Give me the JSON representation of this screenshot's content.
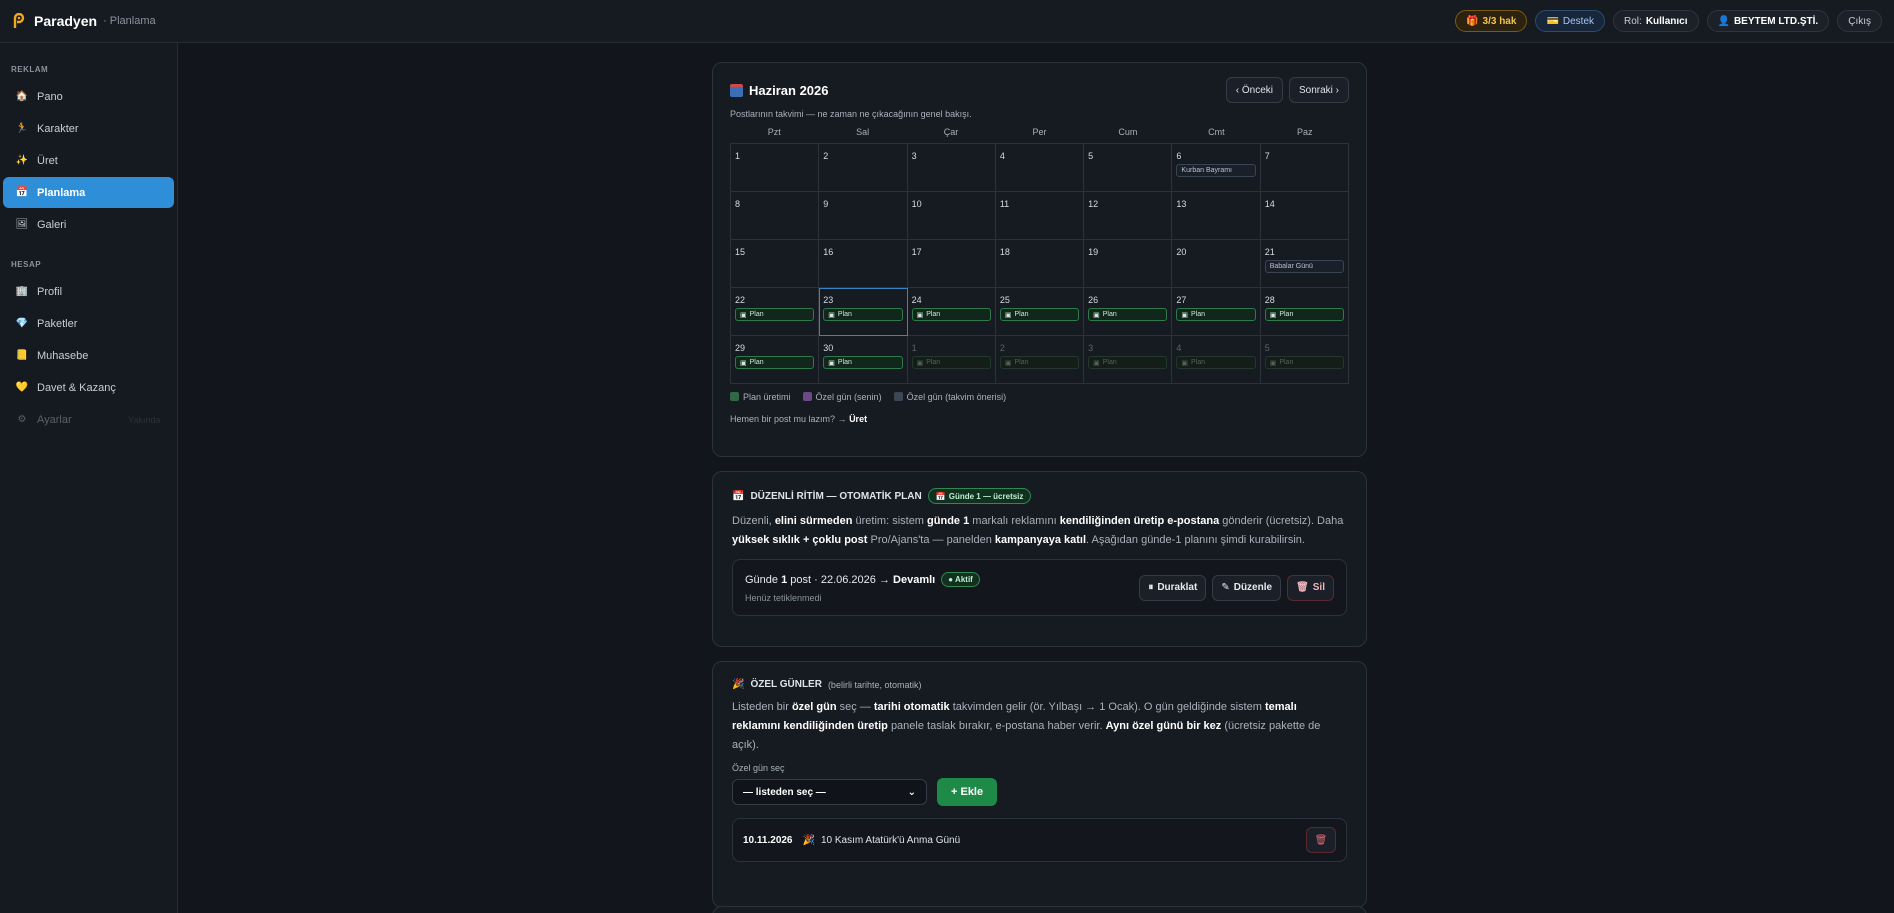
{
  "topbar": {
    "brand": "Paradyen",
    "page": "· Planlama",
    "credit": "3/3 hak",
    "support": "Destek",
    "role_label": "Rol:",
    "role_value": "Kullanıcı",
    "company": "BEYTEM LTD.ŞTİ.",
    "logout": "Çıkış"
  },
  "sidebar": {
    "section_ads": "REKLAM",
    "section_account": "HESAP",
    "items": [
      {
        "label": "Pano",
        "icon": "house-icon"
      },
      {
        "label": "Karakter",
        "icon": "person-run-icon"
      },
      {
        "label": "Üret",
        "icon": "sparkles-icon"
      },
      {
        "label": "Planlama",
        "icon": "calendar-icon"
      },
      {
        "label": "Galeri",
        "icon": "frame-icon"
      },
      {
        "label": "Profil",
        "icon": "building-icon"
      },
      {
        "label": "Paketler",
        "icon": "diamond-icon"
      },
      {
        "label": "Muhasebe",
        "icon": "ledger-icon"
      },
      {
        "label": "Davet & Kazanç",
        "icon": "heart-icon"
      },
      {
        "label": "Ayarlar",
        "icon": "gear-icon",
        "ghost": "Yakında"
      }
    ]
  },
  "calendar": {
    "title": "Haziran 2026",
    "prev": "‹ Önceki",
    "next": "Sonraki ›",
    "subtitle": "Postlarının takvimi — ne zaman ne çıkacağının genel bakışı.",
    "weekdays": [
      "Pzt",
      "Sal",
      "Çar",
      "Per",
      "Cum",
      "Cmt",
      "Paz"
    ],
    "plan_label": "Plan",
    "cells": [
      {
        "d": "1"
      },
      {
        "d": "2"
      },
      {
        "d": "3"
      },
      {
        "d": "4"
      },
      {
        "d": "5"
      },
      {
        "d": "6",
        "special": "Kurban Bayramı"
      },
      {
        "d": "7"
      },
      {
        "d": "8"
      },
      {
        "d": "9"
      },
      {
        "d": "10"
      },
      {
        "d": "11"
      },
      {
        "d": "12"
      },
      {
        "d": "13"
      },
      {
        "d": "14"
      },
      {
        "d": "15"
      },
      {
        "d": "16"
      },
      {
        "d": "17"
      },
      {
        "d": "18"
      },
      {
        "d": "19"
      },
      {
        "d": "20"
      },
      {
        "d": "21",
        "special": "Babalar Günü"
      },
      {
        "d": "22",
        "plan": true
      },
      {
        "d": "23",
        "plan": true,
        "today": true
      },
      {
        "d": "24",
        "plan": true
      },
      {
        "d": "25",
        "plan": true
      },
      {
        "d": "26",
        "plan": true
      },
      {
        "d": "27",
        "plan": true
      },
      {
        "d": "28",
        "plan": true
      },
      {
        "d": "29",
        "plan": true
      },
      {
        "d": "30",
        "plan": true
      },
      {
        "d": "1",
        "plan": true,
        "other": true
      },
      {
        "d": "2",
        "plan": true,
        "other": true
      },
      {
        "d": "3",
        "plan": true,
        "other": true
      },
      {
        "d": "4",
        "plan": true,
        "other": true
      },
      {
        "d": "5",
        "plan": true,
        "other": true
      }
    ],
    "legend": [
      {
        "label": "Plan üretimi",
        "color": "#2f6a45"
      },
      {
        "label": "Özel gün (senin)",
        "color": "#6b4a86"
      },
      {
        "label": "Özel gün (takvim önerisi)",
        "color": "#3d4656"
      }
    ],
    "cta_text": "Hemen bir post mu lazım? →",
    "cta_link": "Üret"
  },
  "rhythm": {
    "title": "DÜZENLİ RİTİM — OTOMATİK PLAN",
    "badge": "Günde 1 — ücretsiz",
    "desc_1": "Düzenli,",
    "desc_b1": "elini sürmeden",
    "desc_2": "üretim: sistem",
    "desc_b2": "günde 1",
    "desc_3": "markalı reklamını",
    "desc_b3": "kendiliğinden üretip e-postana",
    "desc_4": "gönderir (ücretsiz). Daha",
    "desc_b4": "yüksek sıklık + çoklu post",
    "desc_5": "Pro/Ajans'ta — panelden",
    "desc_b5": "kampanyaya katıl",
    "desc_6": ". Aşağıdan günde-1 planını şimdi kurabilirsin.",
    "plan_prefix": "Günde",
    "plan_count": "1",
    "plan_mid": "post · 22.06.2026 →",
    "plan_cont": "Devamlı",
    "plan_status": "● Aktif",
    "plan_sub": "Henüz tetiklenmedi",
    "pause": "Duraklat",
    "edit": "Düzenle",
    "delete": "Sil"
  },
  "special": {
    "title": "ÖZEL GÜNLER",
    "title_note": "(belirli tarihte, otomatik)",
    "desc_1": "Listeden bir",
    "desc_b1": "özel gün",
    "desc_2": "seç —",
    "desc_b2": "tarihi otomatik",
    "desc_3": "takvimden gelir (ör. Yılbaşı → 1 Ocak). O gün geldiğinde sistem",
    "desc_b3": "temalı reklamını kendiliğinden üretip",
    "desc_4": "panele taslak bırakır, e-postana haber verir.",
    "desc_b4": "Aynı özel günü bir kez",
    "desc_5": "(ücretsiz pakette de açık).",
    "field_label": "Özel gün seç",
    "select_value": "— listeden seç —",
    "add": "+ Ekle",
    "rows": [
      {
        "date": "10.11.2026",
        "label": "10 Kasım Atatürk'ü Anma Günü"
      }
    ]
  }
}
